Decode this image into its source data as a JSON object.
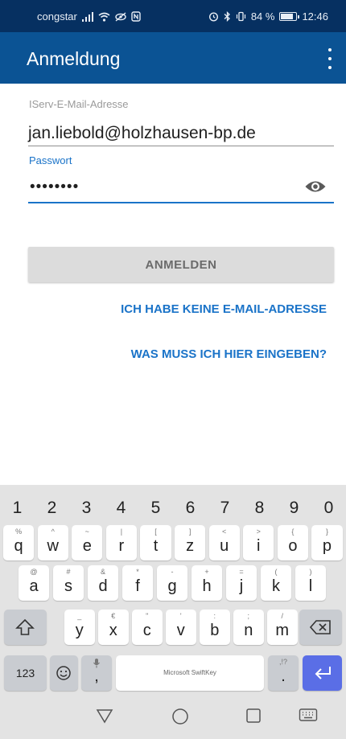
{
  "status_bar": {
    "carrier": "congstar",
    "battery": "84 %",
    "battery_level": 0.84,
    "time": "12:46"
  },
  "app_bar": {
    "title": "Anmeldung",
    "menu_icon": "more-vert-icon"
  },
  "form": {
    "email_label": "IServ-E-Mail-Adresse",
    "email_value": "jan.liebold@holzhausen-bp.de",
    "password_label": "Passwort",
    "password_value": "••••••••",
    "visibility_icon": "eye-icon"
  },
  "actions": {
    "login_label": "ANMELDEN",
    "no_email_label": "ICH HABE KEINE E-MAIL-ADRESSE",
    "help_label": "WAS MUSS ICH HIER EINGEBEN?"
  },
  "keyboard": {
    "brand": "Microsoft SwiftKey",
    "row_numbers": [
      "1",
      "2",
      "3",
      "4",
      "5",
      "6",
      "7",
      "8",
      "9",
      "0"
    ],
    "row1": [
      {
        "key": "q",
        "hint": "%"
      },
      {
        "key": "w",
        "hint": "^"
      },
      {
        "key": "e",
        "hint": "~"
      },
      {
        "key": "r",
        "hint": "|"
      },
      {
        "key": "t",
        "hint": "["
      },
      {
        "key": "z",
        "hint": "]"
      },
      {
        "key": "u",
        "hint": "<"
      },
      {
        "key": "i",
        "hint": ">"
      },
      {
        "key": "o",
        "hint": "{"
      },
      {
        "key": "p",
        "hint": "}"
      }
    ],
    "row2": [
      {
        "key": "a",
        "hint": "@"
      },
      {
        "key": "s",
        "hint": "#"
      },
      {
        "key": "d",
        "hint": "&"
      },
      {
        "key": "f",
        "hint": "*"
      },
      {
        "key": "g",
        "hint": "-"
      },
      {
        "key": "h",
        "hint": "+"
      },
      {
        "key": "j",
        "hint": "="
      },
      {
        "key": "k",
        "hint": "("
      },
      {
        "key": "l",
        "hint": ")"
      }
    ],
    "row3": [
      {
        "key": "y",
        "hint": "_"
      },
      {
        "key": "x",
        "hint": "€"
      },
      {
        "key": "c",
        "hint": "\""
      },
      {
        "key": "v",
        "hint": "'"
      },
      {
        "key": "b",
        "hint": ":"
      },
      {
        "key": "n",
        "hint": ";"
      },
      {
        "key": "m",
        "hint": "/"
      }
    ],
    "numbers_key": "123",
    "comma_key": ",",
    "period_key": ".",
    "period_hint": ",!?",
    "icons": {
      "shift": "shift-icon",
      "backspace": "backspace-icon",
      "emoji": "emoji-icon",
      "mic": "microphone-icon",
      "enter": "enter-icon"
    }
  },
  "nav_bar": {
    "icons": [
      "back-icon",
      "home-icon",
      "recents-icon",
      "keyboard-icon"
    ]
  },
  "colors": {
    "status_bar_bg": "#063061",
    "app_bar_bg": "#0b5394",
    "accent": "#1a73c8",
    "enter_key": "#5a6ee6"
  }
}
